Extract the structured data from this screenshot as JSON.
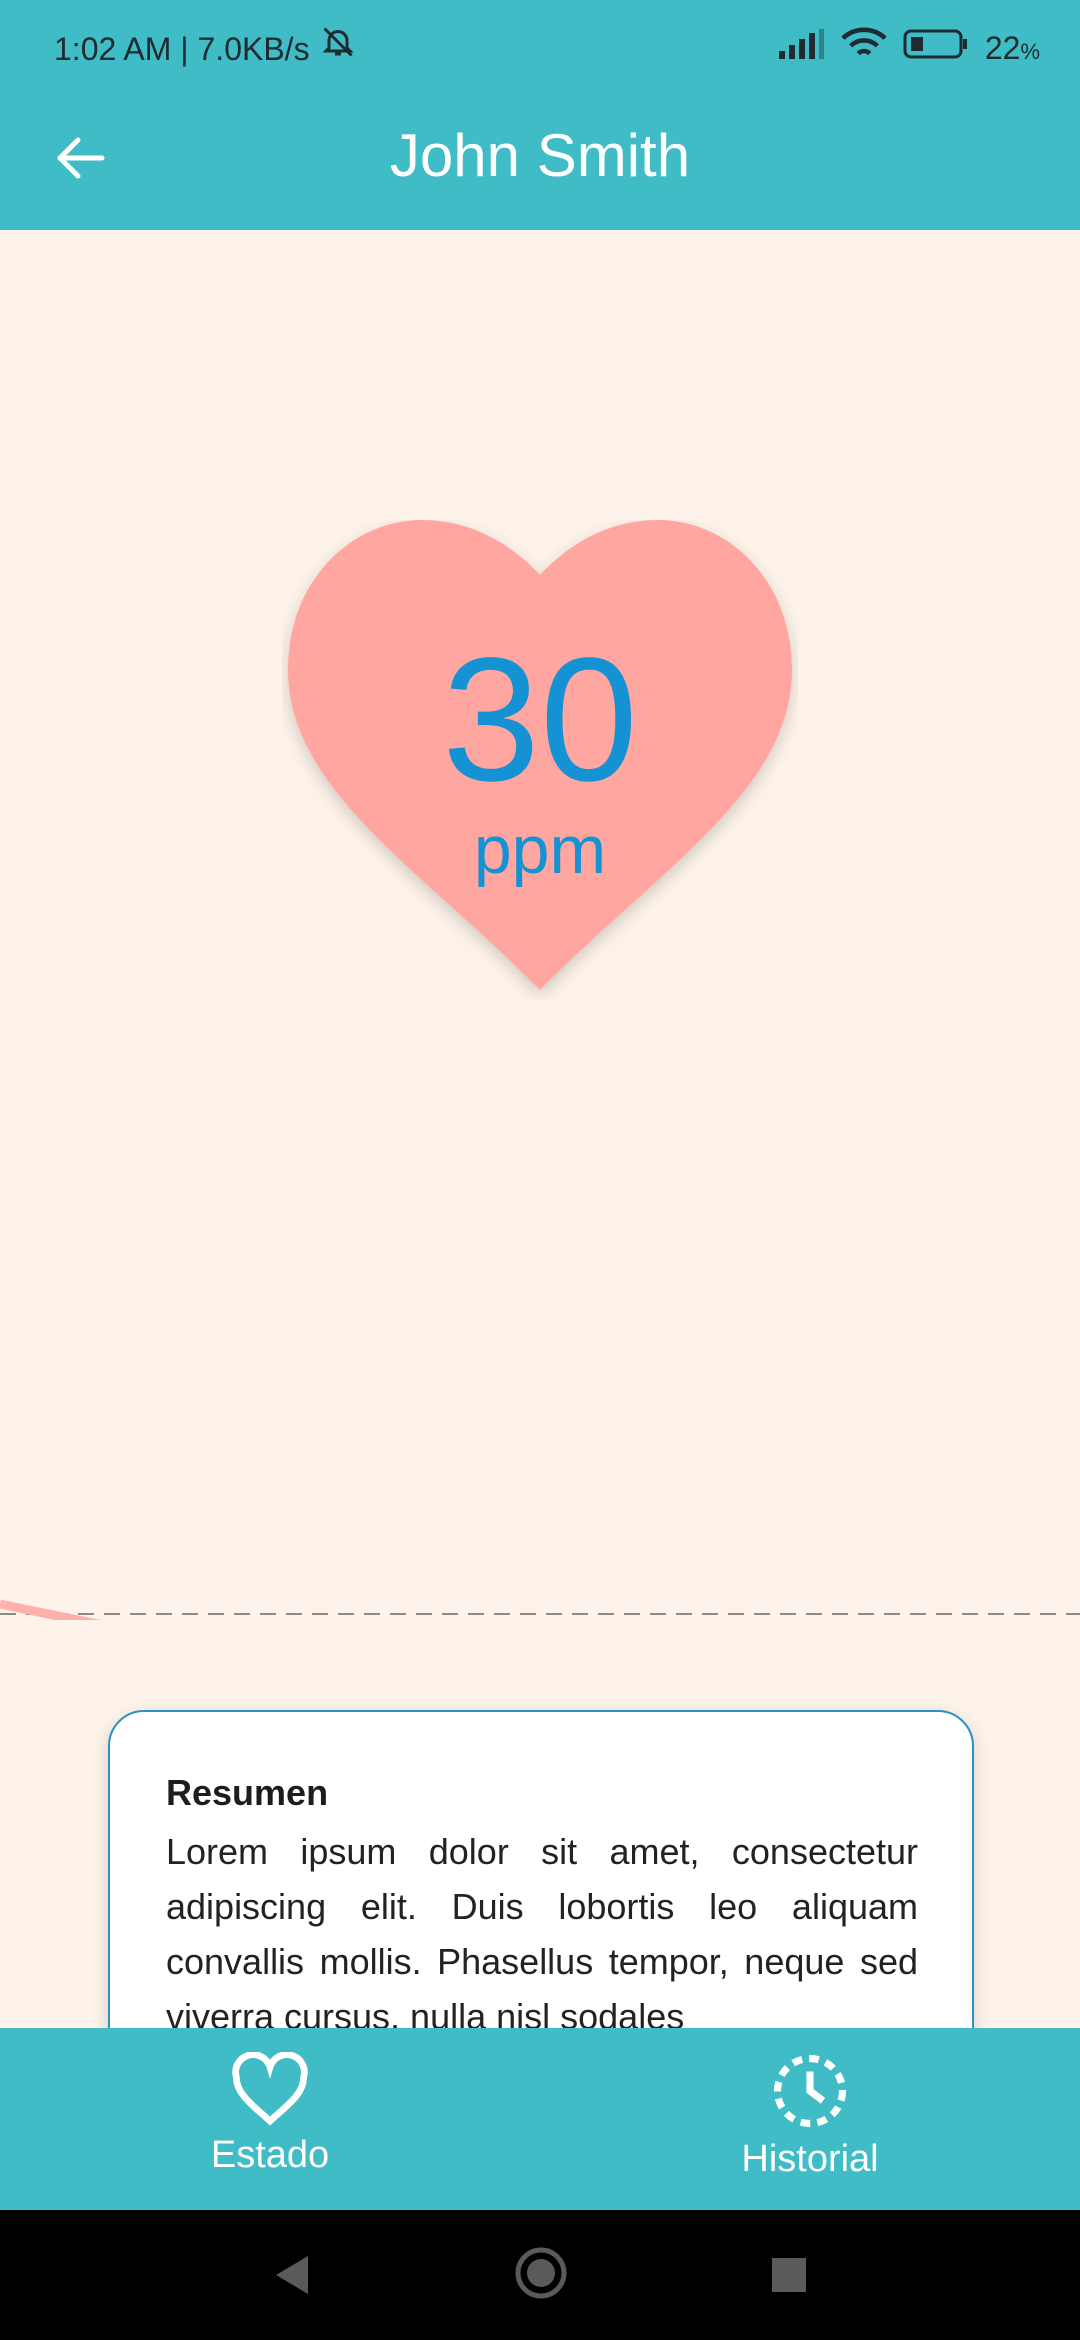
{
  "status_bar": {
    "time_speed": "1:02 AM | 7.0KB/s",
    "battery": "22",
    "battery_unit": "%"
  },
  "app_bar": {
    "title": "John Smith",
    "back_icon": "arrow-left-icon"
  },
  "heart_rate": {
    "value": "30",
    "unit": "ppm"
  },
  "summary": {
    "title": "Resumen",
    "text": "Lorem ipsum dolor sit amet, consectetur adipiscing elit. Duis lobortis leo aliquam convallis mollis. Phasellus tempor, neque sed viverra cursus, nulla nisl sodales"
  },
  "bottom_nav": {
    "estado": "Estado",
    "historial": "Historial"
  },
  "colors": {
    "accent": "#3fbcc5",
    "heart": "#ffa6a0",
    "value": "#1592d4",
    "wave": "#f26b66",
    "background": "#fdf3ea"
  }
}
